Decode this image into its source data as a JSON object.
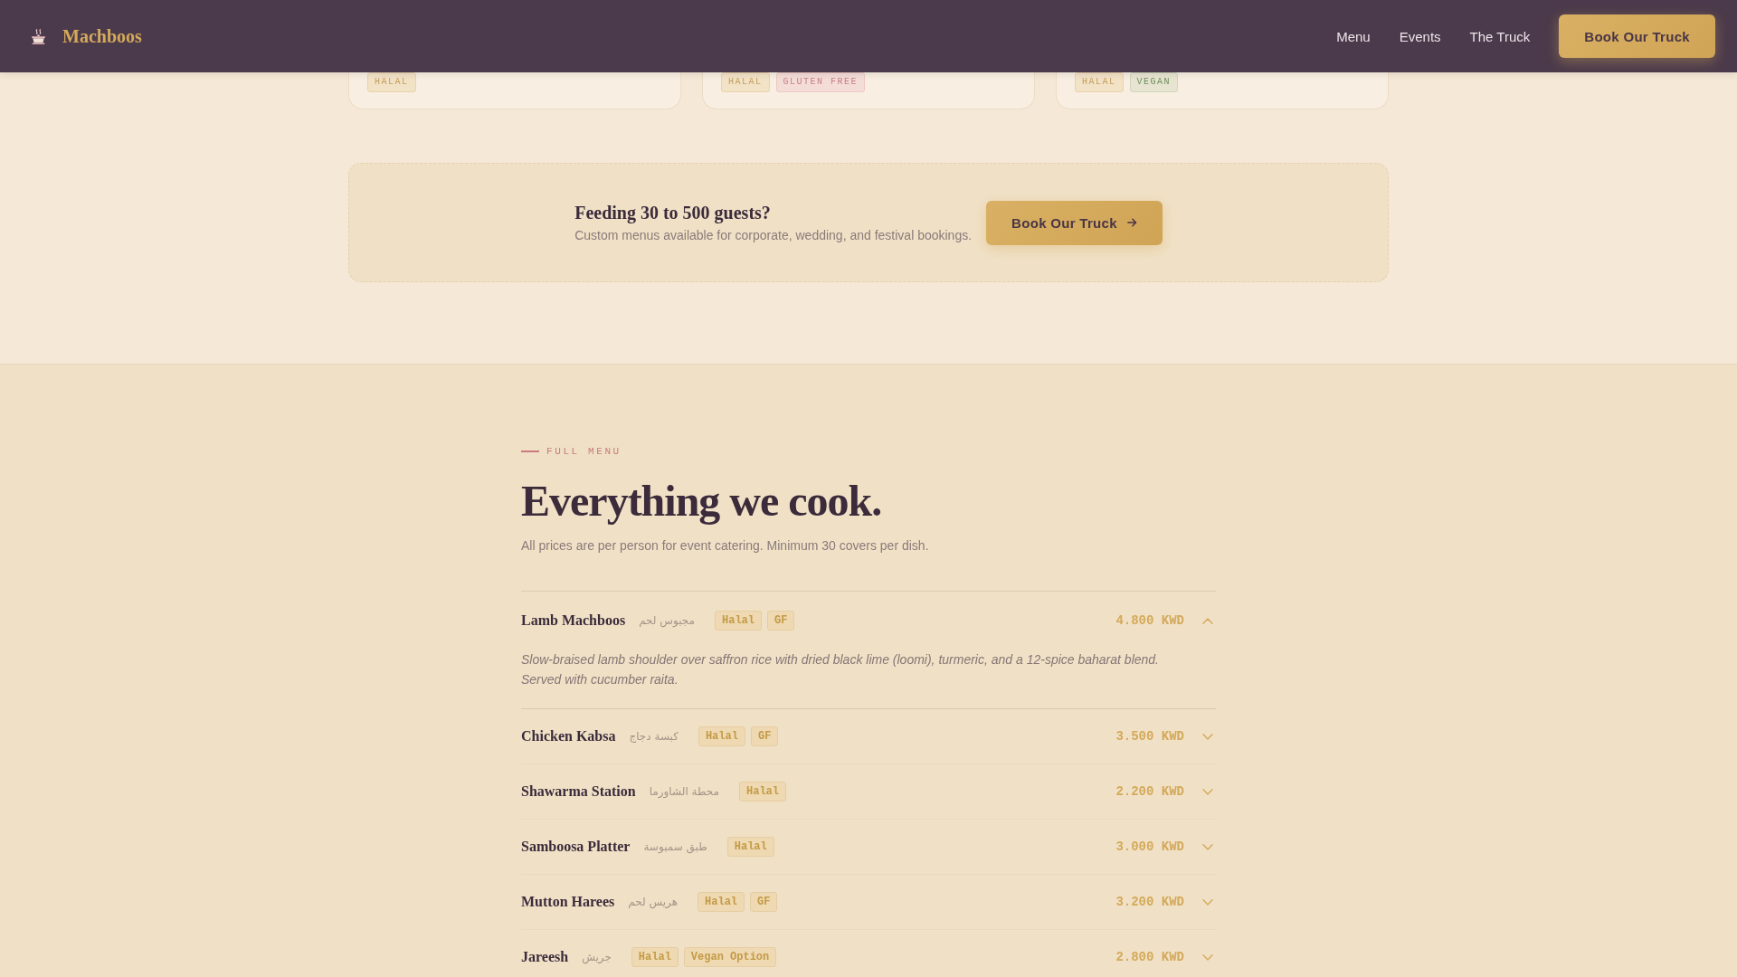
{
  "header": {
    "brand": "Machboos",
    "nav": [
      "Menu",
      "Events",
      "The Truck"
    ],
    "button": "Book Our Truck"
  },
  "dish_cards": [
    {
      "tags": [
        {
          "label": "HALAL",
          "kind": "halal"
        }
      ]
    },
    {
      "tags": [
        {
          "label": "HALAL",
          "kind": "halal"
        },
        {
          "label": "GLUTEN FREE",
          "kind": "gluten_free"
        }
      ]
    },
    {
      "tags": [
        {
          "label": "HALAL",
          "kind": "halal"
        },
        {
          "label": "VEGAN",
          "kind": "vegan"
        }
      ]
    }
  ],
  "booking_banner": {
    "title": "Feeding 30 to 500 guests?",
    "text": "Custom menus available for corporate, wedding, and festival bookings.",
    "button": "Book Our Truck"
  },
  "full_menu": {
    "eyebrow": "FULL MENU",
    "title": "Everything we cook.",
    "subtitle": "All prices are per person for event catering. Minimum 30 covers per dish.",
    "items": [
      {
        "name": "Lamb Machboos",
        "arabic": "مجبوس لحم",
        "tags": [
          "Halal",
          "GF"
        ],
        "price": "4.800 KWD",
        "expanded": true,
        "description": "Slow-braised lamb shoulder over saffron rice with dried black lime (loomi), turmeric, and a 12-spice baharat blend. Served with cucumber raita."
      },
      {
        "name": "Chicken Kabsa",
        "arabic": "كبسة دجاج",
        "tags": [
          "Halal",
          "GF"
        ],
        "price": "3.500 KWD",
        "expanded": false
      },
      {
        "name": "Shawarma Station",
        "arabic": "محطة الشاورما",
        "tags": [
          "Halal"
        ],
        "price": "2.200 KWD",
        "expanded": false
      },
      {
        "name": "Samboosa Platter",
        "arabic": "طبق سمبوسة",
        "tags": [
          "Halal"
        ],
        "price": "3.000 KWD",
        "expanded": false
      },
      {
        "name": "Mutton Harees",
        "arabic": "هريس لحم",
        "tags": [
          "Halal",
          "GF"
        ],
        "price": "3.200 KWD",
        "expanded": false
      },
      {
        "name": "Jareesh",
        "arabic": "جريش",
        "tags": [
          "Halal",
          "Vegan Option"
        ],
        "price": "2.800 KWD",
        "expanded": false
      }
    ]
  }
}
